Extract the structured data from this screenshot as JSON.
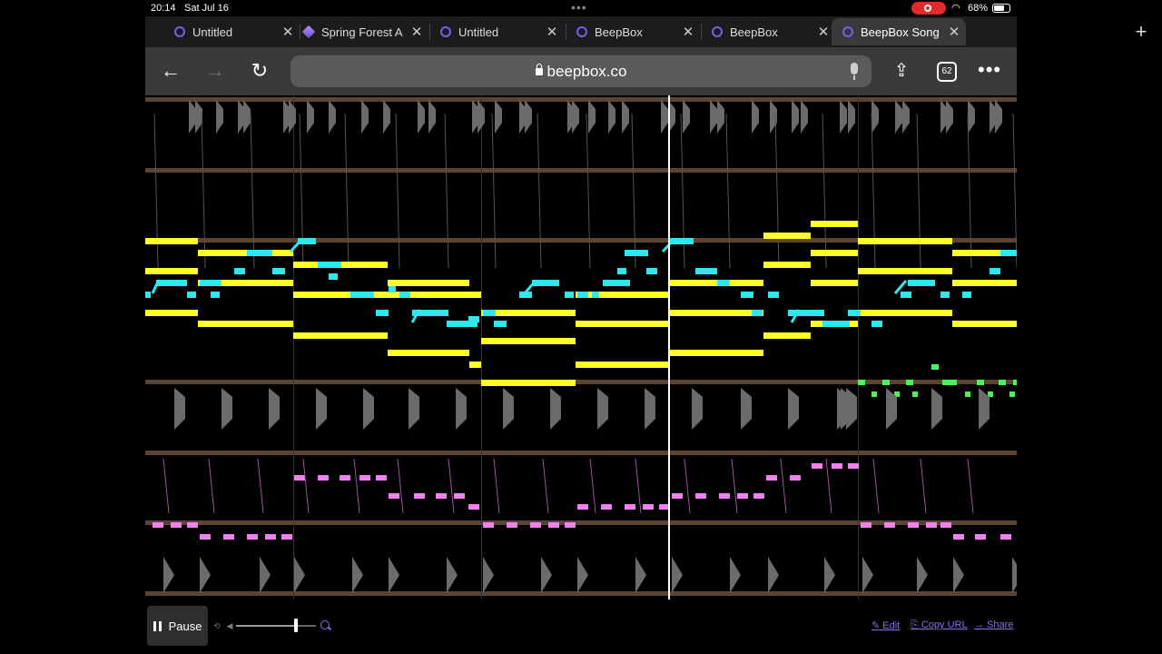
{
  "status_bar": {
    "time": "20:14",
    "date": "Sat Jul 16",
    "battery": "68%",
    "battery_level": 0.68
  },
  "tabs": [
    {
      "label": "Untitled",
      "icon": "beepbox-icon",
      "active": false
    },
    {
      "label": "Spring Forest A",
      "icon": "cube-icon",
      "active": false
    },
    {
      "label": "Untitled",
      "icon": "beepbox-icon",
      "active": false
    },
    {
      "label": "BeepBox",
      "icon": "beepbox-icon",
      "active": false
    },
    {
      "label": "BeepBox",
      "icon": "beepbox-icon",
      "active": false
    },
    {
      "label": "BeepBox Song",
      "icon": "beepbox-icon",
      "active": true
    }
  ],
  "toolbar": {
    "url": "beepbox.co",
    "tab_count": "62"
  },
  "controls": {
    "pause_label": "Pause",
    "volume": 0.75,
    "edit_label": "✎ Edit",
    "copy_url_label": "⎘ Copy URL",
    "share_label": "→ Share"
  },
  "colors": {
    "accent": "#8b6ef0",
    "channel_divider": "#5c4433",
    "pitch_yellow": "#ffff26",
    "pitch_cyan": "#2ee8f0",
    "pitch_green": "#4cf25a",
    "pitch_pink": "#f080f0",
    "drum_gray": "#6b6b6b",
    "playhead": "#ffffff"
  }
}
